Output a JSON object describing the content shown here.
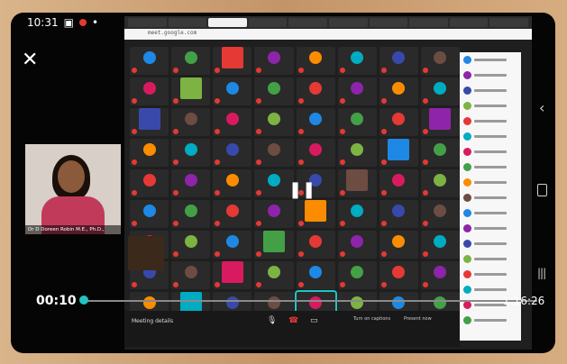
{
  "status": {
    "time": "10:31"
  },
  "browser": {
    "url": "meet.google.com"
  },
  "pip": {
    "caption": "Dr D Doreen Robin M.E., Ph.D.,"
  },
  "player": {
    "elapsed": "00:10",
    "duration": "1:16:26",
    "progress": 0.005
  },
  "meet_bar": {
    "meeting_details": "Meeting details",
    "captions": "Turn on captions",
    "present": "Present now"
  }
}
